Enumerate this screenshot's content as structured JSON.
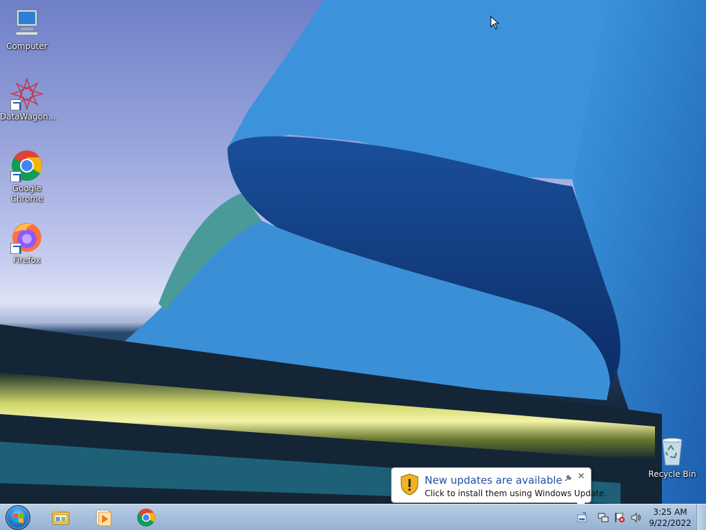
{
  "desktop": {
    "icons": [
      {
        "label": "Computer"
      },
      {
        "label": "DataWagon..."
      },
      {
        "label": "Google Chrome"
      },
      {
        "label": "Firefox"
      },
      {
        "label": "Recycle Bin"
      }
    ]
  },
  "taskbar": {
    "pinned": [
      {
        "icon": "windows-explorer-icon"
      },
      {
        "icon": "media-player-icon"
      },
      {
        "icon": "chrome-icon"
      }
    ],
    "clock": {
      "time": "3:25 AM",
      "date": "9/22/2022"
    }
  },
  "notification": {
    "title": "New updates are available",
    "body": "Click to install them using Windows Update."
  },
  "colors": {
    "taskbar": "#a6c0dc",
    "balloon_title": "#1f4fa8",
    "wallpaper_blue": "#2f7fd0"
  }
}
